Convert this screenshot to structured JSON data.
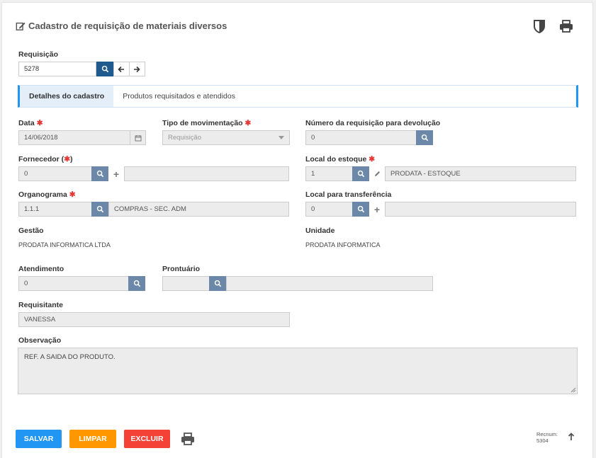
{
  "header": {
    "title": "Cadastro de requisição de materiais diversos"
  },
  "requisicao": {
    "label": "Requisição",
    "value": "5278"
  },
  "tabs": [
    {
      "label": "Detalhes do cadastro"
    },
    {
      "label": "Produtos requisitados e atendidos"
    }
  ],
  "fields": {
    "data": {
      "label": "Data",
      "value": "14/06/2018"
    },
    "tipo": {
      "label": "Tipo de movimentação",
      "value": "Requisição"
    },
    "numero_devolucao": {
      "label": "Número da requisição para devolução",
      "value": "0"
    },
    "fornecedor": {
      "label": "Fornecedor (",
      "label_end": ")",
      "value": "0",
      "desc": ""
    },
    "local_estoque": {
      "label": "Local do estoque",
      "value": "1",
      "desc": "PRODATA - ESTOQUE"
    },
    "organograma": {
      "label": "Organograma",
      "value": "1.1.1",
      "desc": "COMPRAS - SEC. ADM"
    },
    "local_transferencia": {
      "label": "Local para transferência",
      "value": "0",
      "desc": ""
    },
    "gestao": {
      "label": "Gestão",
      "value": "PRODATA INFORMATICA LTDA"
    },
    "unidade": {
      "label": "Unidade",
      "value": "PRODATA INFORMATICA"
    },
    "atendimento": {
      "label": "Atendimento",
      "value": "0"
    },
    "prontuario": {
      "label": "Prontuário",
      "value": "",
      "desc": ""
    },
    "requisitante": {
      "label": "Requisitante",
      "value": "VANESSA"
    },
    "observacao": {
      "label": "Observação",
      "value": "REF. A SAIDA DO PRODUTO."
    }
  },
  "required_mark": "✱",
  "footer": {
    "save": "SALVAR",
    "clear": "LIMPAR",
    "delete": "EXCLUIR",
    "recnum_label": "Recnum:",
    "recnum_value": "5304"
  },
  "colors": {
    "save": "#2196f3",
    "clear": "#ff9800",
    "delete": "#f44336",
    "search_dark": "#1e5a8e",
    "search": "#6b88a8"
  },
  "icons": [
    "edit-icon",
    "shield-icon",
    "print-icon",
    "search-icon",
    "arrow-left-icon",
    "arrow-right-icon",
    "calendar-icon",
    "chevron-down-icon",
    "plus-icon",
    "pencil-icon",
    "arrow-up-icon"
  ]
}
